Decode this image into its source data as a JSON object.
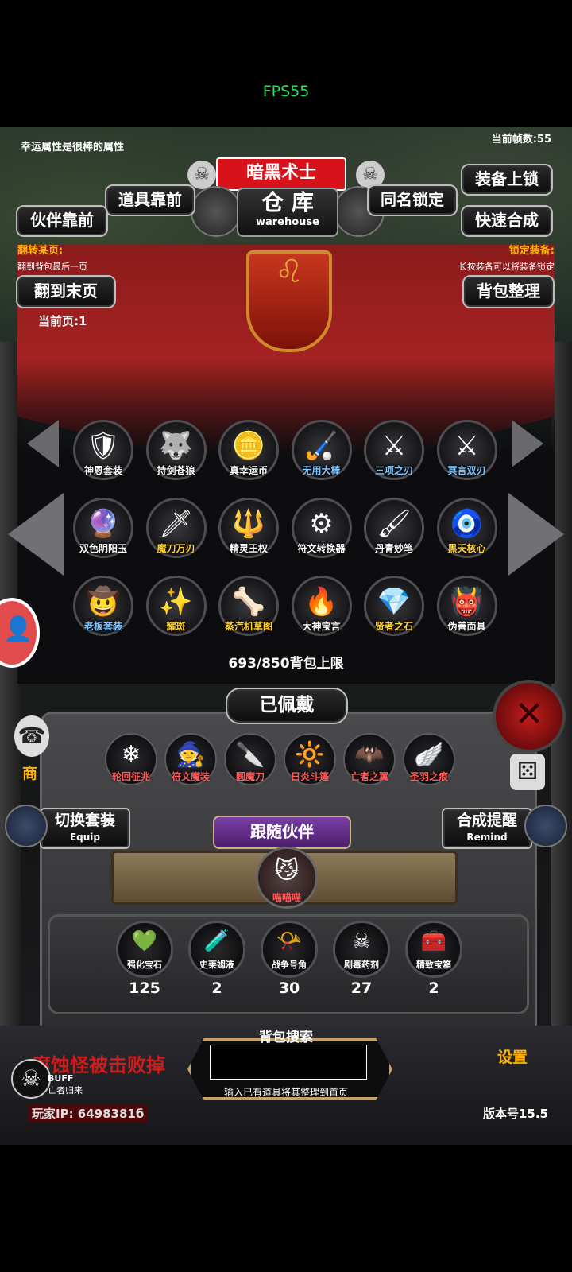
{
  "fps": "FPS55",
  "top": {
    "lucky_text": "幸运属性是很棒的属性",
    "frame_count": "当前帧数:55"
  },
  "header": {
    "title": "暗黑术士",
    "warehouse_cn": "仓 库",
    "warehouse_en": "warehouse"
  },
  "buttons": {
    "items_front": "道具靠前",
    "partner_front": "伙伴靠前",
    "same_lock": "同名锁定",
    "equip_lock": "装备上锁",
    "quick_merge": "快速合成",
    "last_page": "翻到末页",
    "bag_sort": "背包整理"
  },
  "info": {
    "flip_title": "翻转某页:",
    "flip_desc": "翻到背包最后一页",
    "lock_title": "锁定装备:",
    "lock_desc": "长按装备可以将装备锁定",
    "current_page": "当前页:1"
  },
  "inventory": [
    {
      "label": "神恩套装",
      "icon": "armor-set-icon",
      "glyph": "🛡",
      "color": "#ffffff"
    },
    {
      "label": "持剑苍狼",
      "icon": "wolf-icon",
      "glyph": "🐺",
      "color": "#ffffff"
    },
    {
      "label": "真幸运币",
      "icon": "coin-icon",
      "glyph": "🪙",
      "color": "#ffffff"
    },
    {
      "label": "无用大棒",
      "icon": "staff-icon",
      "glyph": "🏑",
      "color": "#7ec6ff"
    },
    {
      "label": "三项之刃",
      "icon": "triple-blade-icon",
      "glyph": "⚔",
      "color": "#7ec6ff"
    },
    {
      "label": "冥言双刃",
      "icon": "dual-blade-icon",
      "glyph": "⚔",
      "color": "#7ec6ff"
    },
    {
      "label": "双色阴阳玉",
      "icon": "yinyang-orb-icon",
      "glyph": "🔮",
      "color": "#ffffff"
    },
    {
      "label": "魔刀万刃",
      "icon": "demon-sword-icon",
      "glyph": "🗡",
      "color": "#ffd23a"
    },
    {
      "label": "精灵王权",
      "icon": "scepter-icon",
      "glyph": "🔱",
      "color": "#ffffff"
    },
    {
      "label": "符文转换器",
      "icon": "rune-converter-icon",
      "glyph": "⚙",
      "color": "#ffffff"
    },
    {
      "label": "丹青妙笔",
      "icon": "brush-icon",
      "glyph": "🖌",
      "color": "#ffffff"
    },
    {
      "label": "黑夭核心",
      "icon": "core-icon",
      "glyph": "🧿",
      "color": "#ffd23a"
    },
    {
      "label": "老板套装",
      "icon": "boss-set-icon",
      "glyph": "🤠",
      "color": "#7ec6ff"
    },
    {
      "label": "耀斑",
      "icon": "flare-icon",
      "glyph": "✨",
      "color": "#ffd23a"
    },
    {
      "label": "蒸汽机草图",
      "icon": "steam-sketch-icon",
      "glyph": "🦴",
      "color": "#ffd23a"
    },
    {
      "label": "大神宝言",
      "icon": "god-words-icon",
      "glyph": "🔥",
      "color": "#ffffff"
    },
    {
      "label": "贤者之石",
      "icon": "sage-stone-icon",
      "glyph": "💎",
      "color": "#ffd23a"
    },
    {
      "label": "伪善面具",
      "icon": "mask-icon",
      "glyph": "👹",
      "color": "#ffffff"
    }
  ],
  "bag_limit": "693/850背包上限",
  "equipped": {
    "title": "已佩戴",
    "items": [
      {
        "label": "轮回征兆",
        "icon": "omen-icon",
        "glyph": "❄",
        "color": "#ff5a5a"
      },
      {
        "label": "符文魔装",
        "icon": "rune-armor-icon",
        "glyph": "🧙",
        "color": "#ff5a5a"
      },
      {
        "label": "圆魔刀",
        "icon": "round-blade-icon",
        "glyph": "🔪",
        "color": "#ff5a5a"
      },
      {
        "label": "日炎斗篷",
        "icon": "sun-cloak-icon",
        "glyph": "🔆",
        "color": "#ff5a5a"
      },
      {
        "label": "亡者之翼",
        "icon": "dead-wing-icon",
        "glyph": "🦇",
        "color": "#ff5a5a"
      },
      {
        "label": "圣羽之痕",
        "icon": "holy-feather-icon",
        "glyph": "🪽",
        "color": "#ff5a5a"
      }
    ],
    "switch_set": "切换套装",
    "switch_set_en": "Equip",
    "merge_remind": "合成提醒",
    "merge_remind_en": "Remind"
  },
  "partner": {
    "title": "跟随伙伴",
    "name": "喵喵喵"
  },
  "materials": [
    {
      "label": "强化宝石",
      "count": "125",
      "icon": "enhance-gem-icon",
      "glyph": "💚"
    },
    {
      "label": "史莱姆液",
      "count": "2",
      "icon": "slime-potion-icon",
      "glyph": "🧪"
    },
    {
      "label": "战争号角",
      "count": "30",
      "icon": "war-horn-icon",
      "glyph": "📯"
    },
    {
      "label": "剧毒药剂",
      "count": "27",
      "icon": "poison-potion-icon",
      "glyph": "☠"
    },
    {
      "label": "精致宝箱",
      "count": "2",
      "icon": "treasure-chest-icon",
      "glyph": "🧰"
    }
  ],
  "search": {
    "title": "背包搜索",
    "hint": "输入已有道具将其整理到首页"
  },
  "bottom": {
    "kill_msg": "腐蚀怪被击败掉",
    "buff": "BUFF",
    "buff_sub": "亡者归来",
    "player_ip": "玩家IP:  6498381б",
    "version": "版本号15.5",
    "settings": "设置",
    "shop": "商"
  }
}
